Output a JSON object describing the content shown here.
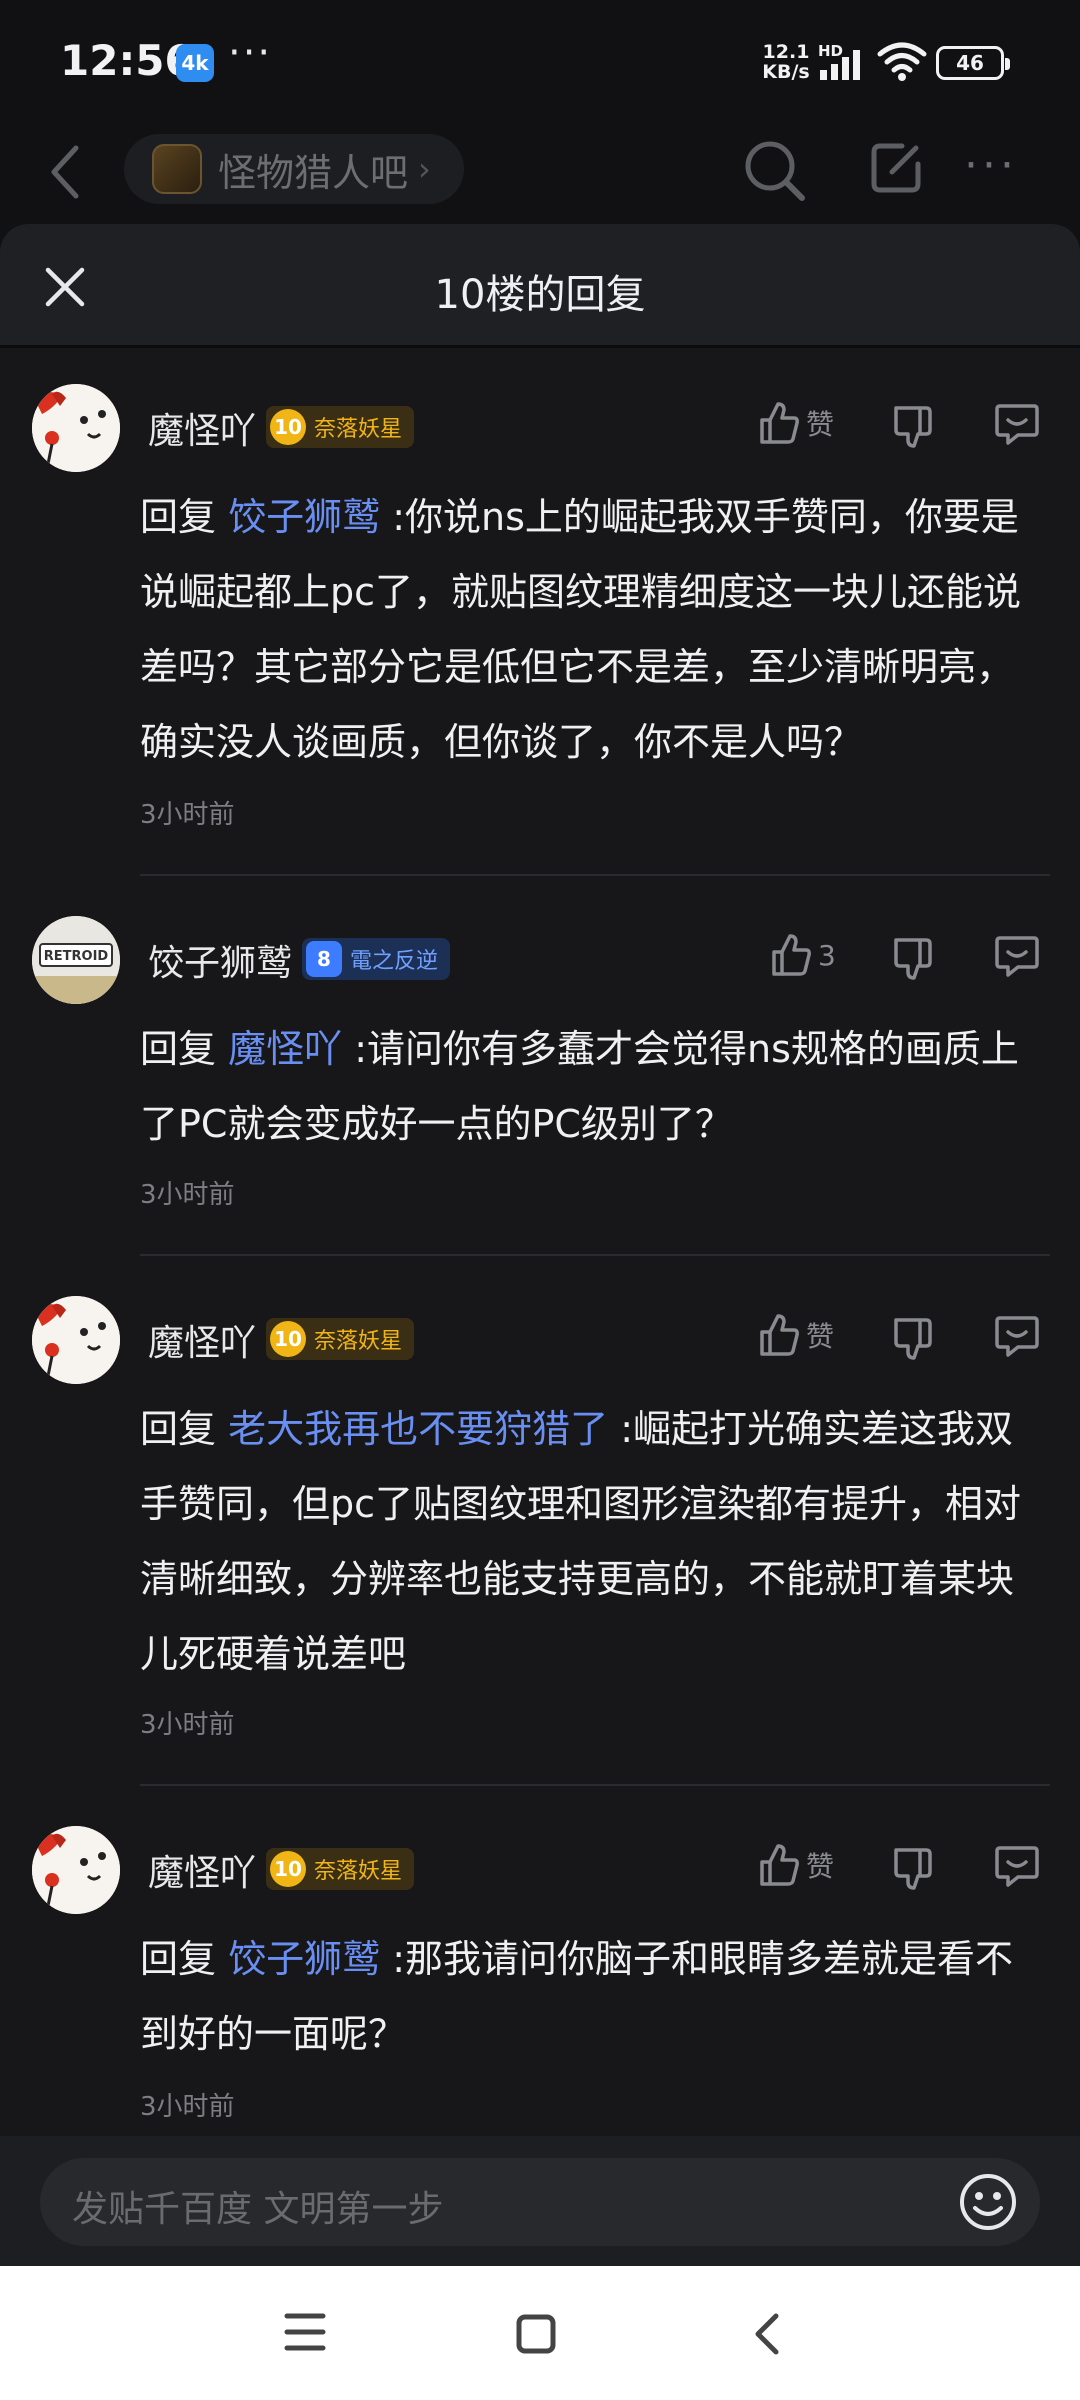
{
  "status_bar": {
    "time": "12:56",
    "app_icon_text": "4k",
    "more": "···",
    "net_speed_value": "12.1",
    "net_speed_unit": "KB/s",
    "hd": "HD",
    "battery": "46"
  },
  "nav": {
    "forum_name": "怪物猎人吧"
  },
  "sheet": {
    "title": "10楼的回复",
    "replies": [
      {
        "author": "魔怪吖",
        "level": "10",
        "level_title": "奈落妖星",
        "like_label": "赞",
        "reply_prefix": "回复",
        "mention": "饺子狮鹫",
        "text": ":你说ns上的崛起我双手赞同，你要是说崛起都上pc了，就贴图纹理精细度这一块儿还能说差吗？其它部分它是低但它不是差，至少清晰明亮，确实没人谈画质，但你谈了，你不是人吗？",
        "time": "3小时前"
      },
      {
        "author": "饺子狮鹫",
        "level": "8",
        "level_title": "電之反逆",
        "like_label": "3",
        "reply_prefix": "回复",
        "mention": "魔怪吖",
        "text": ":请问你有多蠢才会觉得ns规格的画质上了PC就会变成好一点的PC级别了？",
        "time": "3小时前"
      },
      {
        "author": "魔怪吖",
        "level": "10",
        "level_title": "奈落妖星",
        "like_label": "赞",
        "reply_prefix": "回复",
        "mention": "老大我再也不要狩猎了",
        "text": ":崛起打光确实差这我双手赞同，但pc了贴图纹理和图形渲染都有提升，相对清晰细致，分辨率也能支持更高的，不能就盯着某块儿死硬着说差吧",
        "time": "3小时前"
      },
      {
        "author": "魔怪吖",
        "level": "10",
        "level_title": "奈落妖星",
        "like_label": "赞",
        "reply_prefix": "回复",
        "mention": "饺子狮鹫",
        "text": ":那我请问你脑子和眼睛多差就是看不到好的一面呢？",
        "time": "3小时前"
      }
    ]
  },
  "input": {
    "placeholder": "发贴千百度 文明第一步"
  },
  "colors": {
    "mention": "#6a8ff2",
    "gold_badge": "#f1b516",
    "blue_badge": "#3d7bff",
    "background": "#17171a"
  }
}
